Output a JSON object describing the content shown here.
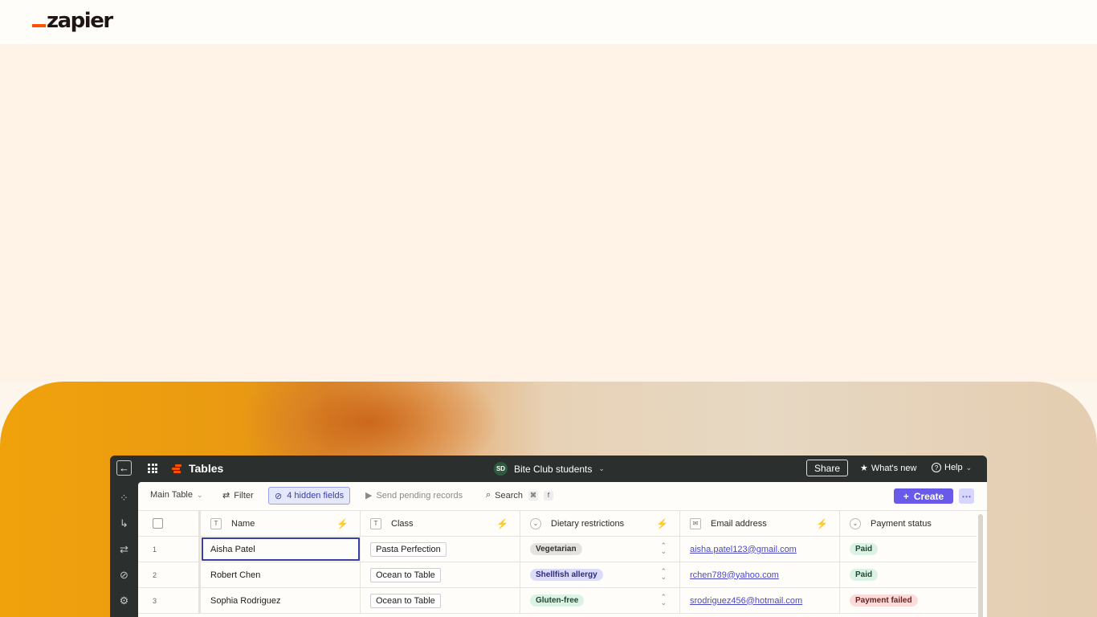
{
  "brand": {
    "logo_text": "zapier"
  },
  "app": {
    "title": "Tables",
    "workspace": {
      "initials": "SD",
      "name": "Bite Club students"
    },
    "header_buttons": {
      "share": "Share",
      "whats_new": "What's new",
      "help": "Help"
    },
    "toolbar": {
      "table_selector": "Main Table",
      "filter": "Filter",
      "hidden_fields": "4 hidden fields",
      "send_pending": "Send pending records",
      "search": "Search",
      "search_shortcut_1": "⌘",
      "search_shortcut_2": "f",
      "create": "Create"
    },
    "columns": [
      {
        "label": "Name",
        "type_icon": "text-type-icon"
      },
      {
        "label": "Class",
        "type_icon": "text-type-icon"
      },
      {
        "label": "Dietary restrictions",
        "type_icon": "dropdown-type-icon"
      },
      {
        "label": "Email address",
        "type_icon": "email-type-icon"
      },
      {
        "label": "Payment status",
        "type_icon": "dropdown-type-icon"
      }
    ],
    "rows": [
      {
        "num": "1",
        "name": "Aisha Patel",
        "class": "Pasta Perfection",
        "diet": "Vegetarian",
        "email": "aisha.patel123@gmail.com",
        "payment": "Paid"
      },
      {
        "num": "2",
        "name": "Robert Chen",
        "class": "Ocean to Table",
        "diet": "Shellfish allergy",
        "email": "rchen789@yahoo.com",
        "payment": "Paid"
      },
      {
        "num": "3",
        "name": "Sophia Rodriguez",
        "class": "Ocean to Table",
        "diet": "Gluten-free",
        "email": "srodriguez456@hotmail.com",
        "payment": "Payment failed"
      }
    ],
    "colors": {
      "accent": "#695be8",
      "brand_orange": "#ff4f00",
      "vegetarian_pill": "#e6e3df",
      "shellfish_pill": "#dcdcf8",
      "glutenfree_pill": "#dcf2e4",
      "paid_pill": "#dcf2e4",
      "failed_pill": "#fbdcda"
    }
  }
}
